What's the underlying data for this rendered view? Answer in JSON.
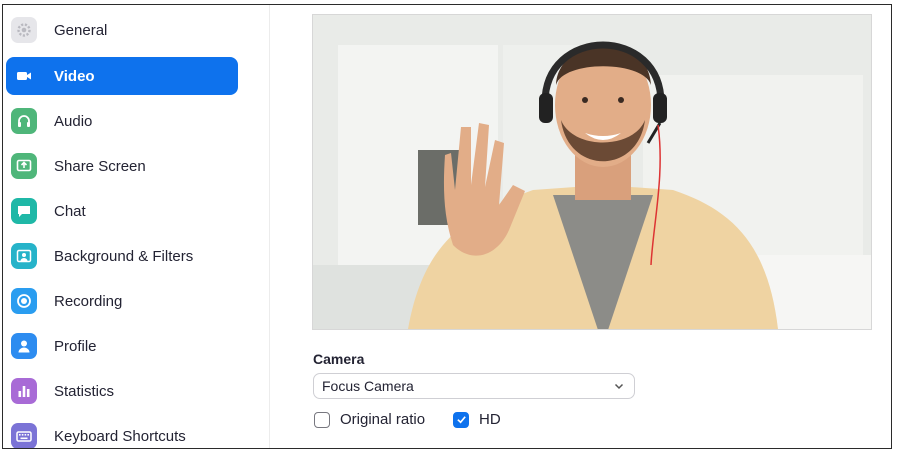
{
  "sidebar": {
    "items": [
      {
        "label": "General",
        "icon": "gear-icon",
        "color": "#e6e6ea",
        "active": false
      },
      {
        "label": "Video",
        "icon": "video-camera-icon",
        "color": "#0e72ed",
        "active": true
      },
      {
        "label": "Audio",
        "icon": "headphones-icon",
        "color": "#4fb67a",
        "active": false
      },
      {
        "label": "Share Screen",
        "icon": "share-screen-icon",
        "color": "#4fb67a",
        "active": false
      },
      {
        "label": "Chat",
        "icon": "chat-bubble-icon",
        "color": "#1fb8a7",
        "active": false
      },
      {
        "label": "Background & Filters",
        "icon": "background-person-icon",
        "color": "#26b3c9",
        "active": false
      },
      {
        "label": "Recording",
        "icon": "record-icon",
        "color": "#2a9df0",
        "active": false
      },
      {
        "label": "Profile",
        "icon": "profile-person-icon",
        "color": "#2d8cf0",
        "active": false
      },
      {
        "label": "Statistics",
        "icon": "bar-chart-icon",
        "color": "#a86bd6",
        "active": false
      },
      {
        "label": "Keyboard Shortcuts",
        "icon": "keyboard-icon",
        "color": "#7b73d6",
        "active": false
      }
    ]
  },
  "video": {
    "camera_label": "Camera",
    "camera_value": "Focus Camera",
    "original_ratio_label": "Original ratio",
    "original_ratio_checked": false,
    "hd_label": "HD",
    "hd_checked": true
  },
  "colors": {
    "accent": "#0e72ed"
  }
}
